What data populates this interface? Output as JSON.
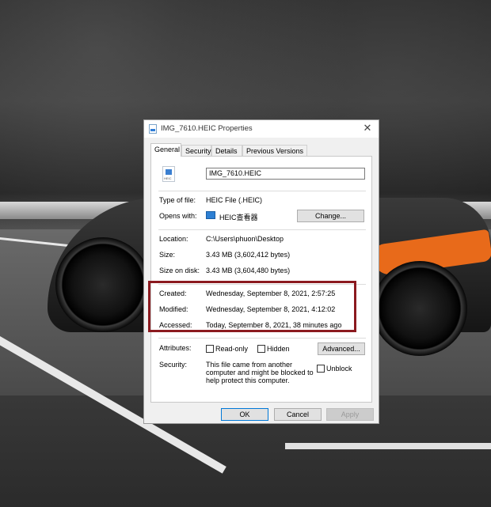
{
  "window": {
    "title": "IMG_7610.HEIC Properties",
    "close_glyph": "✕"
  },
  "tabs": [
    "General",
    "Security",
    "Details",
    "Previous Versions"
  ],
  "general": {
    "icon_label": "HEIC",
    "filename": "IMG_7610.HEIC",
    "type_label": "Type of file:",
    "type_value": "HEIC File (.HEIC)",
    "opens_label": "Opens with:",
    "opens_value": "HEIC查看器",
    "change_button": "Change...",
    "location_label": "Location:",
    "location_value": "C:\\Users\\phuon\\Desktop",
    "size_label": "Size:",
    "size_value": "3.43 MB (3,602,412 bytes)",
    "size_disk_label": "Size on disk:",
    "size_disk_value": "3.43 MB (3,604,480 bytes)",
    "created_label": "Created:",
    "created_value": "Wednesday, September 8, 2021, 2:57:25",
    "modified_label": "Modified:",
    "modified_value": "Wednesday, September 8, 2021, 4:12:02",
    "accessed_label": "Accessed:",
    "accessed_value": "Today, September 8, 2021, 38 minutes ago",
    "attributes_label": "Attributes:",
    "readonly_label": "Read-only",
    "hidden_label": "Hidden",
    "advanced_button": "Advanced...",
    "security_label": "Security:",
    "security_text": "This file came from another computer and might be blocked to help protect this computer.",
    "unblock_label": "Unblock"
  },
  "footer": {
    "ok": "OK",
    "cancel": "Cancel",
    "apply": "Apply"
  },
  "colors": {
    "highlight_border": "#8b1a1f",
    "accent": "#0078d7",
    "car_accent": "#e86a1a"
  }
}
